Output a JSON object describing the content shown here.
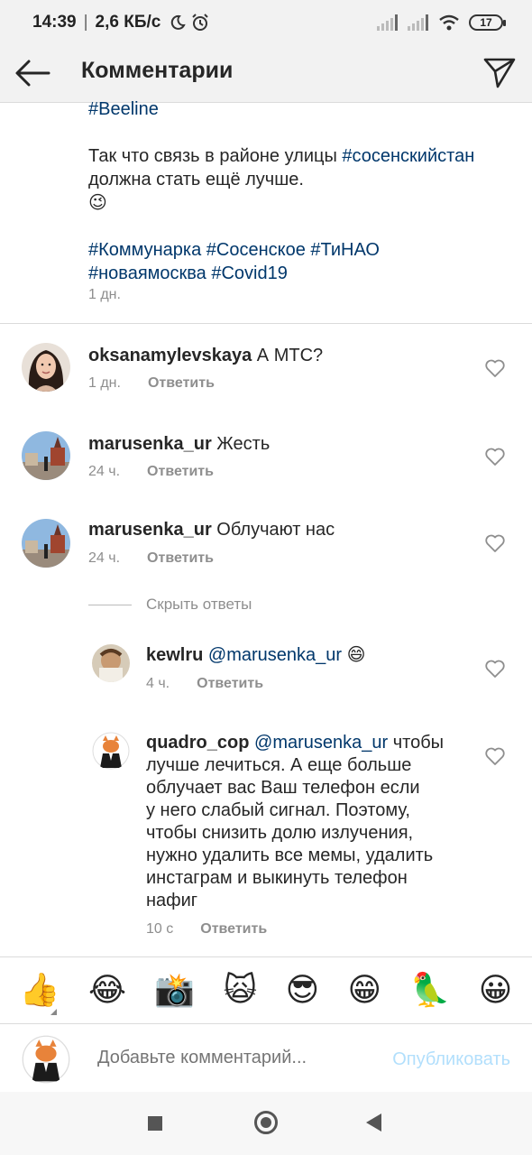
{
  "status_bar": {
    "time": "14:39",
    "speed": "2,6 КБ/с",
    "battery": "17"
  },
  "header": {
    "title": "Комментарии"
  },
  "caption": {
    "line1_tag": "#Beeline",
    "para2_text_a": "Так что связь в районе улицы ",
    "para2_tag": "#сосенскийстан",
    "para2_text_b": " должна стать ещё лучше. ",
    "para2_emoji": "😉",
    "tags_line1": "#Коммунарка #Сосенское #ТиНАО",
    "tags_line2": "#новаямосква #Covid19",
    "time": "1 дн."
  },
  "comments": [
    {
      "username": "oksanamylevskaya",
      "text": " А МТС?",
      "time": "1 дн.",
      "reply_label": "Ответить"
    },
    {
      "username": "marusenka_ur",
      "text": " Жесть",
      "time": "24 ч.",
      "reply_label": "Ответить"
    },
    {
      "username": "marusenka_ur",
      "text": " Облучают нас",
      "time": "24 ч.",
      "reply_label": "Ответить"
    }
  ],
  "hide_replies_label": "Скрыть ответы",
  "replies": [
    {
      "username": "kewlru",
      "mention": "@marusenka_ur",
      "text": " 😄",
      "time": "4 ч.",
      "reply_label": "Ответить"
    },
    {
      "username": "quadro_cop",
      "mention": "@marusenka_ur",
      "text_line1_rest": " чтобы",
      "text_lines": [
        "лучше  лечиться. А еще больше",
        "облучает вас Ваш телефон если",
        "у него слабый сигнал. Поэтому,",
        "чтобы снизить долю излучения,",
        "нужно удалить все мемы, удалить",
        "инстаграм и выкинуть телефон",
        "нафиг"
      ],
      "time": "10 с",
      "reply_label": "Ответить"
    }
  ],
  "emoji_bar": [
    "👍",
    "😂",
    "📸",
    "🙀",
    "😎",
    "😁",
    "🦜",
    "😀"
  ],
  "composer": {
    "placeholder": "Добавьте комментарий...",
    "publish_label": "Опубликовать"
  },
  "colors": {
    "link": "#00376b",
    "meta": "#8e8e8e",
    "publish_disabled": "#b2dffc"
  }
}
